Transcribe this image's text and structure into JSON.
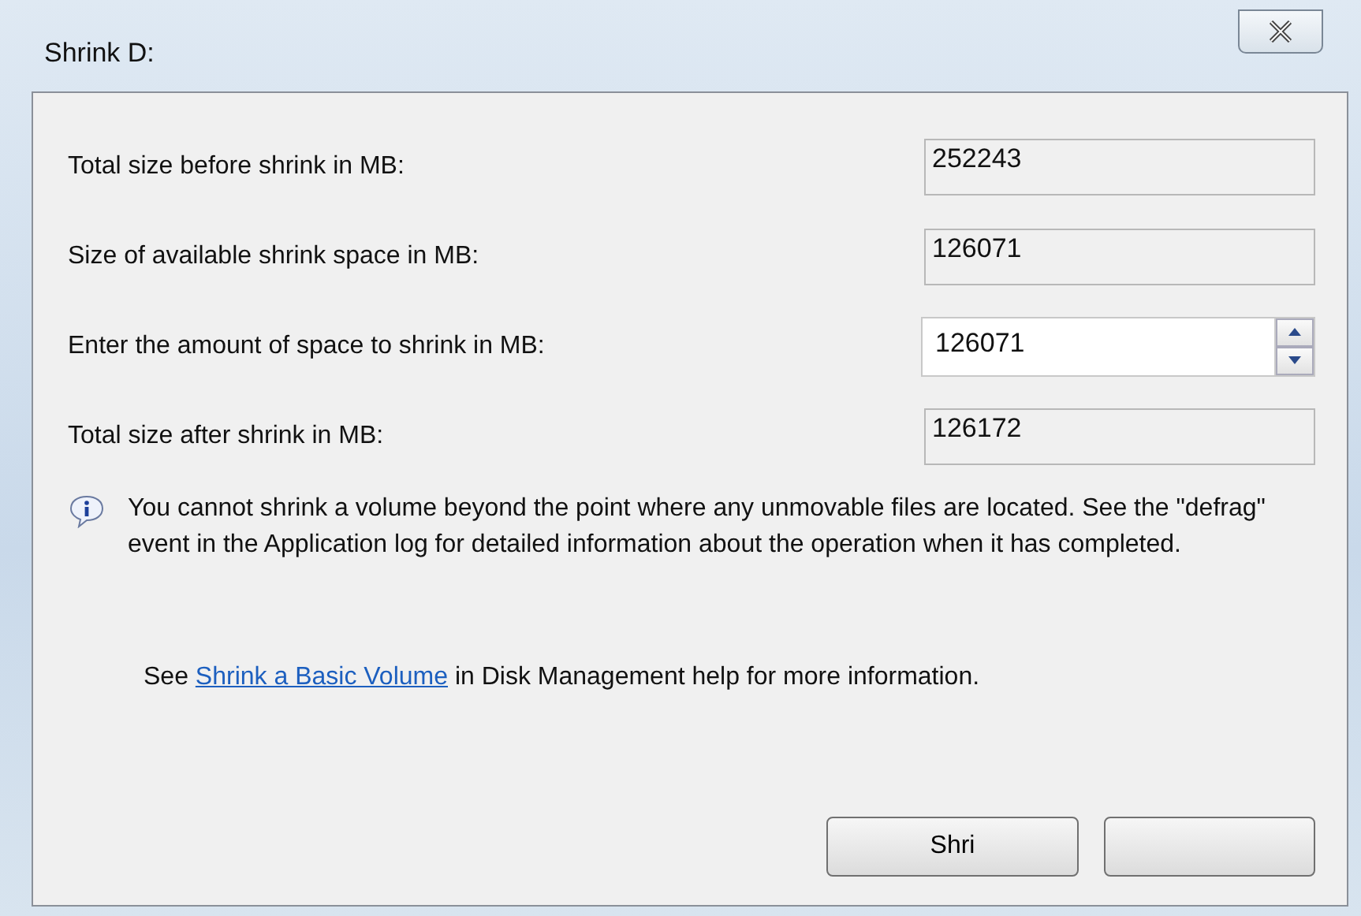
{
  "window": {
    "title": "Shrink D:"
  },
  "fields": [
    {
      "label": "Total size before shrink in MB:",
      "value": "252243",
      "kind": "readonly"
    },
    {
      "label": "Size of available shrink space in MB:",
      "value": "126071",
      "kind": "readonly"
    },
    {
      "label": "Enter the amount of space to shrink in MB:",
      "value": "126071",
      "kind": "spinner"
    },
    {
      "label": "Total size after shrink in MB:",
      "value": "126172",
      "kind": "readonly"
    }
  ],
  "info": "You cannot shrink a volume beyond the point where any unmovable files are located. See the \"defrag\" event in the Application log for detailed information about the operation when it has completed.",
  "help": {
    "before": "See",
    "link": "Shrink a Basic Volume",
    "after": "in Disk Management help for more information."
  },
  "buttons": [
    {
      "kind": "labeled",
      "label": "Shri"
    },
    {
      "kind": "blank"
    }
  ]
}
